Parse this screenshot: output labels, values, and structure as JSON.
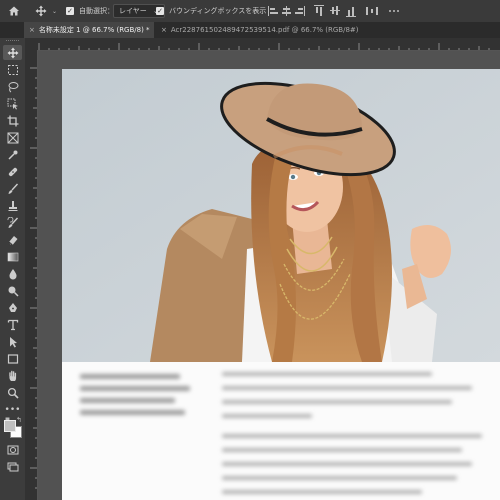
{
  "options_bar": {
    "home_icon": "home-icon",
    "move_tool_icon": "move-icon",
    "auto_select_label": "自動選択：",
    "auto_select_checked": true,
    "auto_select_target": "レイヤー",
    "bounding_box_label": "バウンディングボックスを表示",
    "bounding_box_checked": true
  },
  "tabs": [
    {
      "label": "名称未設定 1 @ 66.7% (RGB/8) *",
      "active": true,
      "close": "×"
    },
    {
      "label": "Acr228761502489472539514.pdf @ 66.7% (RGB/8#)",
      "active": false,
      "close": "×"
    }
  ],
  "tools": [
    "move-tool-icon",
    "marquee-tool-icon",
    "lasso-tool-icon",
    "object-select-tool-icon",
    "crop-tool-icon",
    "frame-tool-icon",
    "eyedropper-tool-icon",
    "healing-brush-icon",
    "brush-tool-icon",
    "clone-stamp-icon",
    "history-brush-icon",
    "eraser-tool-icon",
    "gradient-tool-icon",
    "blur-tool-icon",
    "dodge-tool-icon",
    "pen-tool-icon",
    "type-tool-icon",
    "path-select-icon",
    "rectangle-tool-icon",
    "hand-tool-icon",
    "zoom-tool-icon",
    "more-tools-icon"
  ],
  "colors": {
    "foreground": "#bfbfbf",
    "background": "#ffffff",
    "ui_dark": "#282828",
    "canvas_bg": "#525252",
    "hat": "#c9a07e",
    "coat": "#b98e66",
    "photo_bg": "#c6d0d6"
  }
}
